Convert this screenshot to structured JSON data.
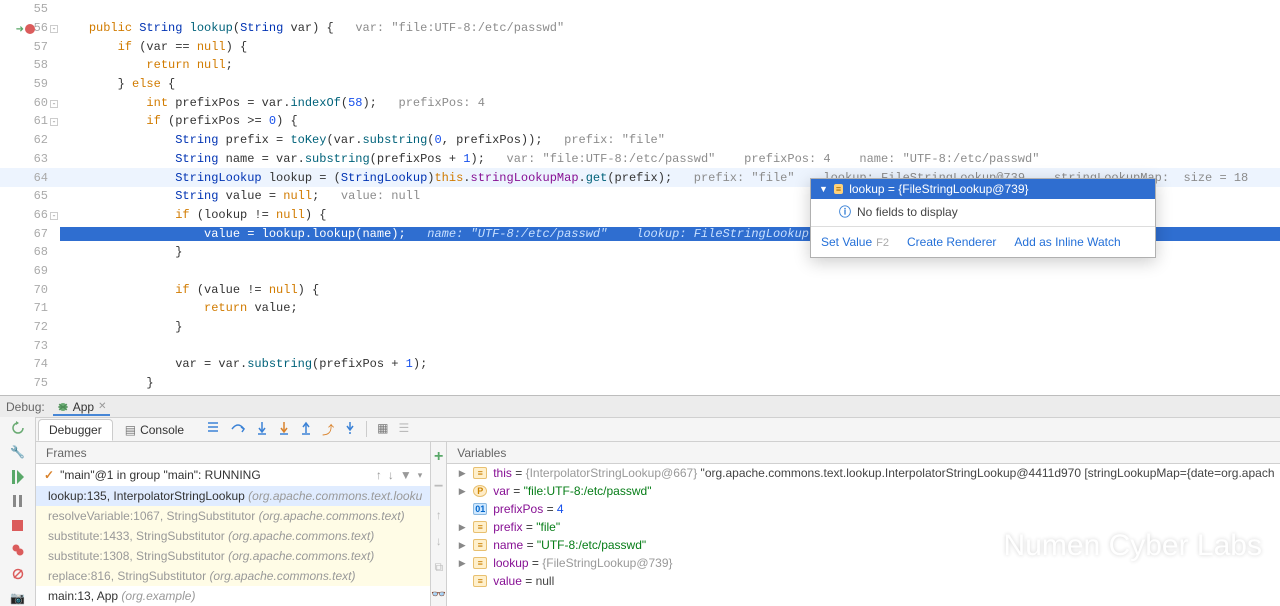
{
  "editor": {
    "lines": {
      "55": {
        "frags": []
      },
      "56": {
        "frags": [
          {
            "t": "    ",
            "c": ""
          },
          {
            "t": "public",
            "c": "k-o"
          },
          {
            "t": " ",
            "c": ""
          },
          {
            "t": "String",
            "c": "k-b"
          },
          {
            "t": " ",
            "c": ""
          },
          {
            "t": "lookup",
            "c": "k-f"
          },
          {
            "t": "(",
            "c": ""
          },
          {
            "t": "String",
            "c": "k-b"
          },
          {
            "t": " var) {   ",
            "c": ""
          },
          {
            "t": "var: \"file:UTF-8:/etc/passwd\"",
            "c": "k-g"
          }
        ],
        "fold": true,
        "break": true
      },
      "57": {
        "frags": [
          {
            "t": "        ",
            "c": ""
          },
          {
            "t": "if",
            "c": "k-o"
          },
          {
            "t": " (var == ",
            "c": ""
          },
          {
            "t": "null",
            "c": "k-o"
          },
          {
            "t": ") {",
            "c": ""
          }
        ]
      },
      "58": {
        "frags": [
          {
            "t": "            ",
            "c": ""
          },
          {
            "t": "return",
            "c": "k-o"
          },
          {
            "t": " ",
            "c": ""
          },
          {
            "t": "null",
            "c": "k-o"
          },
          {
            "t": ";",
            "c": ""
          }
        ]
      },
      "59": {
        "frags": [
          {
            "t": "        } ",
            "c": ""
          },
          {
            "t": "else",
            "c": "k-o"
          },
          {
            "t": " {",
            "c": ""
          }
        ]
      },
      "60": {
        "frags": [
          {
            "t": "            ",
            "c": ""
          },
          {
            "t": "int",
            "c": "k-o"
          },
          {
            "t": " prefixPos = var.",
            "c": ""
          },
          {
            "t": "indexOf",
            "c": "k-f"
          },
          {
            "t": "(",
            "c": ""
          },
          {
            "t": "58",
            "c": "k-n"
          },
          {
            "t": ");   ",
            "c": ""
          },
          {
            "t": "prefixPos: 4",
            "c": "k-g"
          }
        ],
        "fold": true
      },
      "61": {
        "frags": [
          {
            "t": "            ",
            "c": ""
          },
          {
            "t": "if",
            "c": "k-o"
          },
          {
            "t": " (prefixPos >= ",
            "c": ""
          },
          {
            "t": "0",
            "c": "k-n"
          },
          {
            "t": ") {",
            "c": ""
          }
        ],
        "fold": true
      },
      "62": {
        "frags": [
          {
            "t": "                ",
            "c": ""
          },
          {
            "t": "String",
            "c": "k-b"
          },
          {
            "t": " prefix = ",
            "c": ""
          },
          {
            "t": "toKey",
            "c": "k-f"
          },
          {
            "t": "(var.",
            "c": ""
          },
          {
            "t": "substring",
            "c": "k-f"
          },
          {
            "t": "(",
            "c": ""
          },
          {
            "t": "0",
            "c": "k-n"
          },
          {
            "t": ", prefixPos));   ",
            "c": ""
          },
          {
            "t": "prefix: \"file\"",
            "c": "k-g"
          }
        ]
      },
      "63": {
        "frags": [
          {
            "t": "                ",
            "c": ""
          },
          {
            "t": "String",
            "c": "k-b"
          },
          {
            "t": " name = var.",
            "c": ""
          },
          {
            "t": "substring",
            "c": "k-f"
          },
          {
            "t": "(prefixPos + ",
            "c": ""
          },
          {
            "t": "1",
            "c": "k-n"
          },
          {
            "t": ");   ",
            "c": ""
          },
          {
            "t": "var: \"file:UTF-8:/etc/passwd\"    prefixPos: 4    name: \"UTF-8:/etc/passwd\"",
            "c": "k-g"
          }
        ]
      },
      "64": {
        "frags": [
          {
            "t": "                ",
            "c": ""
          },
          {
            "t": "StringLookup",
            "c": "k-b"
          },
          {
            "t": " lookup = (",
            "c": ""
          },
          {
            "t": "StringLookup",
            "c": "k-b"
          },
          {
            "t": ")",
            "c": ""
          },
          {
            "t": "this",
            "c": "k-o"
          },
          {
            "t": ".",
            "c": ""
          },
          {
            "t": "stringLookupMap",
            "c": "k-p"
          },
          {
            "t": ".",
            "c": ""
          },
          {
            "t": "get",
            "c": "k-f"
          },
          {
            "t": "(prefix);   ",
            "c": ""
          },
          {
            "t": "prefix: \"file\"    lookup: FileStringLookup@739    stringLookupMap:  size = 18",
            "c": "k-g"
          }
        ],
        "hl": "line"
      },
      "65": {
        "frags": [
          {
            "t": "                ",
            "c": ""
          },
          {
            "t": "String",
            "c": "k-b"
          },
          {
            "t": " value = ",
            "c": ""
          },
          {
            "t": "null",
            "c": "k-o"
          },
          {
            "t": ";   ",
            "c": ""
          },
          {
            "t": "value: null",
            "c": "k-g"
          }
        ]
      },
      "66": {
        "frags": [
          {
            "t": "                ",
            "c": ""
          },
          {
            "t": "if",
            "c": "k-o"
          },
          {
            "t": " (lookup != ",
            "c": ""
          },
          {
            "t": "null",
            "c": "k-o"
          },
          {
            "t": ") {",
            "c": ""
          }
        ],
        "fold": true
      },
      "67": {
        "frags": [
          {
            "t": "                    value = lookup.",
            "c": ""
          },
          {
            "t": "lookup",
            "c": "k-f"
          },
          {
            "t": "(name);   ",
            "c": ""
          },
          {
            "t": "name: \"UTF-8:/etc/passwd\"    lookup: FileStringLookup",
            "c": "k-c"
          }
        ],
        "hl": "exec"
      },
      "68": {
        "frags": [
          {
            "t": "                }",
            "c": ""
          }
        ]
      },
      "69": {
        "frags": [
          {
            "t": "",
            "c": ""
          }
        ]
      },
      "70": {
        "frags": [
          {
            "t": "                ",
            "c": ""
          },
          {
            "t": "if",
            "c": "k-o"
          },
          {
            "t": " (value != ",
            "c": ""
          },
          {
            "t": "null",
            "c": "k-o"
          },
          {
            "t": ") {",
            "c": ""
          }
        ]
      },
      "71": {
        "frags": [
          {
            "t": "                    ",
            "c": ""
          },
          {
            "t": "return",
            "c": "k-o"
          },
          {
            "t": " value;",
            "c": ""
          }
        ]
      },
      "72": {
        "frags": [
          {
            "t": "                }",
            "c": ""
          }
        ]
      },
      "73": {
        "frags": [
          {
            "t": "",
            "c": ""
          }
        ]
      },
      "74": {
        "frags": [
          {
            "t": "                var = var.",
            "c": ""
          },
          {
            "t": "substring",
            "c": "k-f"
          },
          {
            "t": "(prefixPos + ",
            "c": ""
          },
          {
            "t": "1",
            "c": "k-n"
          },
          {
            "t": ");",
            "c": ""
          }
        ]
      },
      "75": {
        "frags": [
          {
            "t": "            }",
            "c": ""
          }
        ]
      }
    },
    "popup": {
      "header_value": "lookup = {FileStringLookup@739}",
      "body_text": "No fields to display",
      "actions": {
        "set_value": "Set Value",
        "set_value_sc": "F2",
        "create_renderer": "Create Renderer",
        "inline_watch": "Add as Inline Watch"
      }
    }
  },
  "tabstrip": {
    "debug_label": "Debug:",
    "tab_name": "App"
  },
  "toolbar": {
    "debugger_tab": "Debugger",
    "console_tab": "Console"
  },
  "frames": {
    "title": "Frames",
    "thread": "\"main\"@1 in group \"main\": RUNNING",
    "rows": [
      {
        "loc": "lookup:135, InterpolatorStringLookup",
        "pkg": "(org.apache.commons.text.looku",
        "sel": true
      },
      {
        "loc": "resolveVariable:1067, StringSubstitutor",
        "pkg": "(org.apache.commons.text)",
        "lib": true,
        "dim": true
      },
      {
        "loc": "substitute:1433, StringSubstitutor",
        "pkg": "(org.apache.commons.text)",
        "lib": true,
        "dim": true
      },
      {
        "loc": "substitute:1308, StringSubstitutor",
        "pkg": "(org.apache.commons.text)",
        "lib": true,
        "dim": true
      },
      {
        "loc": "replace:816, StringSubstitutor",
        "pkg": "(org.apache.commons.text)",
        "lib": true,
        "dim": true
      },
      {
        "loc": "main:13, App",
        "pkg": "(org.example)"
      }
    ]
  },
  "variables": {
    "title": "Variables",
    "rows": [
      {
        "badge": "f",
        "key": "this",
        "op": " = ",
        "obj": "{InterpolatorStringLookup@667}",
        "extra": " \"org.apache.commons.text.lookup.InterpolatorStringLookup@4411d970 [stringLookupMap={date=org.apach",
        "chev": true
      },
      {
        "badge": "p",
        "key": "var",
        "op": " = ",
        "str": "\"file:UTF-8:/etc/passwd\"",
        "chev": true
      },
      {
        "badge": "n",
        "key": "prefixPos",
        "op": " = ",
        "num": "4",
        "chev": false
      },
      {
        "badge": "f",
        "key": "prefix",
        "op": " = ",
        "str": "\"file\"",
        "chev": true
      },
      {
        "badge": "f",
        "key": "name",
        "op": " = ",
        "str": "\"UTF-8:/etc/passwd\"",
        "chev": true
      },
      {
        "badge": "f",
        "key": "lookup",
        "op": " = ",
        "obj": "{FileStringLookup@739}",
        "chev": true
      },
      {
        "badge": "f",
        "key": "value",
        "op": " = ",
        "extra": "null",
        "chev": false
      }
    ]
  },
  "watermark": {
    "text": "Numen Cyber Labs"
  }
}
